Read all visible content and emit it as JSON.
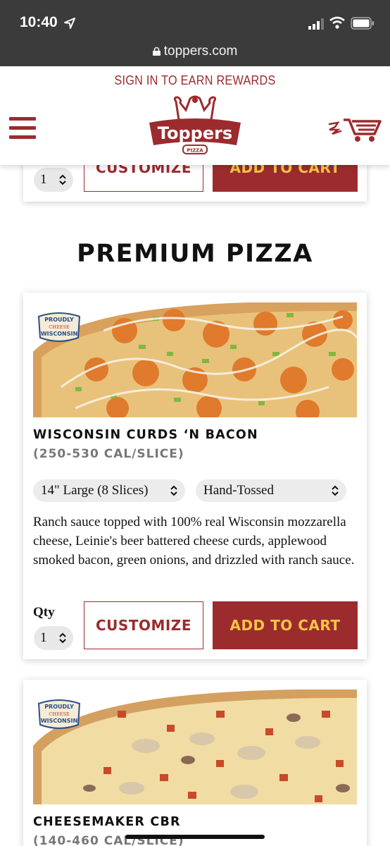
{
  "status_bar": {
    "time": "10:40",
    "url": "toppers.com"
  },
  "header": {
    "rewards_link": "SIGN IN TO EARN REWARDS",
    "logo_text": "Toppers",
    "logo_sub": "PIZZA"
  },
  "previous_item": {
    "qty": "1",
    "customize_label": "CUSTOMIZE",
    "add_to_cart_label": "ADD TO CART"
  },
  "section": {
    "title": "PREMIUM PIZZA"
  },
  "products": [
    {
      "badge": [
        "PROUDLY",
        "CHEESE",
        "WISCONSIN"
      ],
      "name": "WISCONSIN CURDS ‘N BACON",
      "calories": "(250-530 CAL/SLICE)",
      "size": "14\" Large (8 Slices)",
      "crust": "Hand-Tossed",
      "description": "Ranch sauce topped with 100% real Wisconsin mozzarella cheese, Leinie's beer battered cheese curds, applewood smoked bacon, green onions, and drizzled with ranch sauce.",
      "qty_label": "Qty",
      "qty": "1",
      "customize_label": "CUSTOMIZE",
      "add_to_cart_label": "ADD TO CART"
    },
    {
      "badge": [
        "PROUDLY",
        "CHEESE",
        "WISCONSIN"
      ],
      "name": "CHEESEMAKER CBR",
      "calories": "(140-460 CAL/SLICE)"
    }
  ],
  "colors": {
    "brand_red": "#9c2b2e",
    "cta_yellow": "#f6c544",
    "status_bar": "#3b3b3b"
  },
  "icons": [
    "location-arrow-icon",
    "signal-icon",
    "wifi-icon",
    "battery-icon",
    "lock-icon",
    "hamburger-menu-icon",
    "cart-icon",
    "chevron-updown-icon"
  ]
}
